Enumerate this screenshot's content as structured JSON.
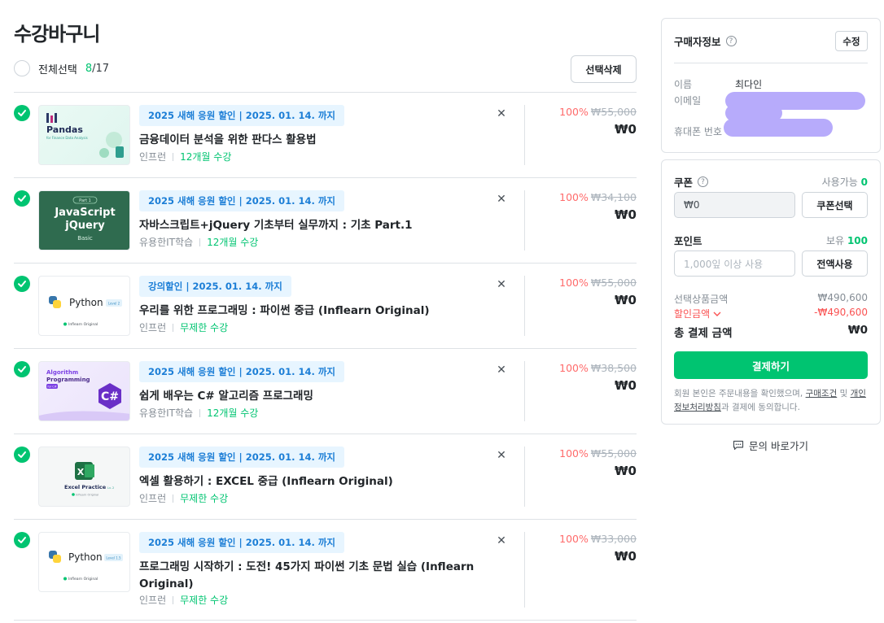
{
  "page_title": "수강바구니",
  "select_all": {
    "label": "전체선택",
    "selected": "8",
    "total": "/17"
  },
  "delete_button": "선택삭제",
  "items": [
    {
      "thumb_title": "Pandas",
      "thumb_sub": "for Finance Data Analysis",
      "badge": "2025 새해 응원 할인  |  2025. 01. 14. 까지",
      "name": "금융데이터 분석을 위한 판다스 활용법",
      "instructor": "인프런",
      "period": "12개월 수강",
      "discount": "100%",
      "original_price": "₩55,000",
      "final_price": "₩0"
    },
    {
      "thumb_top": "Part 1",
      "thumb_title": "JavaScript",
      "thumb_title2": "jQuery",
      "thumb_sub": "Basic",
      "badge": "2025 새해 응원 할인  |  2025. 01. 14. 까지",
      "name": "자바스크립트+jQuery 기초부터 실무까지 : 기초 Part.1",
      "instructor": "유용한IT학습",
      "period": "12개월 수강",
      "discount": "100%",
      "original_price": "₩34,100",
      "final_price": "₩0"
    },
    {
      "thumb_title": "Python",
      "thumb_level": "Level 2",
      "thumb_sub": "Inflearn Original",
      "badge": "강의할인  |  2025. 01. 14. 까지",
      "name": "우리를 위한 프로그래밍 : 파이썬 중급 (Inflearn Original)",
      "instructor": "인프런",
      "period": "무제한 수강",
      "discount": "100%",
      "original_price": "₩55,000",
      "final_price": "₩0"
    },
    {
      "thumb_title": "Algorithm",
      "thumb_title2": "Programming",
      "thumb_level": "for C#",
      "badge": "2025 새해 응원 할인  |  2025. 01. 14. 까지",
      "name": "쉽게 배우는 C# 알고리즘 프로그래밍",
      "instructor": "유용한IT학습",
      "period": "12개월 수강",
      "discount": "100%",
      "original_price": "₩38,500",
      "final_price": "₩0"
    },
    {
      "thumb_title": "Excel Practice",
      "thumb_level": "Lv. 2",
      "thumb_sub": "Inflearn Original",
      "badge": "2025 새해 응원 할인  |  2025. 01. 14. 까지",
      "name": "엑셀 활용하기 : EXCEL 중급 (Inflearn Original)",
      "instructor": "인프런",
      "period": "무제한 수강",
      "discount": "100%",
      "original_price": "₩55,000",
      "final_price": "₩0"
    },
    {
      "thumb_title": "Python",
      "thumb_level": "Level 1.5",
      "thumb_sub": "Inflearn Original",
      "badge": "2025 새해 응원 할인  |  2025. 01. 14. 까지",
      "name": "프로그래밍 시작하기 : 도전! 45가지 파이썬 기초 문법 실습 (Inflearn Original)",
      "instructor": "인프런",
      "period": "무제한 수강",
      "discount": "100%",
      "original_price": "₩33,000",
      "final_price": "₩0"
    }
  ],
  "buyer": {
    "title": "구매자정보",
    "edit": "수정",
    "name_label": "이름",
    "name_value": "최다인",
    "email_label": "이메일",
    "phone_label": "휴대폰 번호"
  },
  "coupon": {
    "label": "쿠폰",
    "available_label": "사용가능",
    "available_count": "0",
    "value": "₩0",
    "button": "쿠폰선택"
  },
  "point": {
    "label": "포인트",
    "hold_label": "보유",
    "hold_value": "100",
    "placeholder": "1,000잎 이상 사용",
    "button": "전액사용"
  },
  "summary": {
    "selected_label": "선택상품금액",
    "selected_value": "₩490,600",
    "discount_label": "할인금액",
    "discount_value": "-₩490,600",
    "total_label": "총 결제 금액",
    "total_value": "₩0"
  },
  "pay_button": "결제하기",
  "agreement": {
    "prefix": "회원 본인은 주문내용을 확인했으며, ",
    "link1": "구매조건",
    "mid": " 및 ",
    "link2": "개인정보처리방침",
    "suffix": "과 결제에 동의합니다."
  },
  "inquiry": "문의 바로가기",
  "colors": {
    "accent": "#00c471",
    "discount_red": "#fa5252",
    "badge_bg": "#e7f5ff",
    "badge_text": "#1c7ed6",
    "redaction": "#b7abfb"
  }
}
